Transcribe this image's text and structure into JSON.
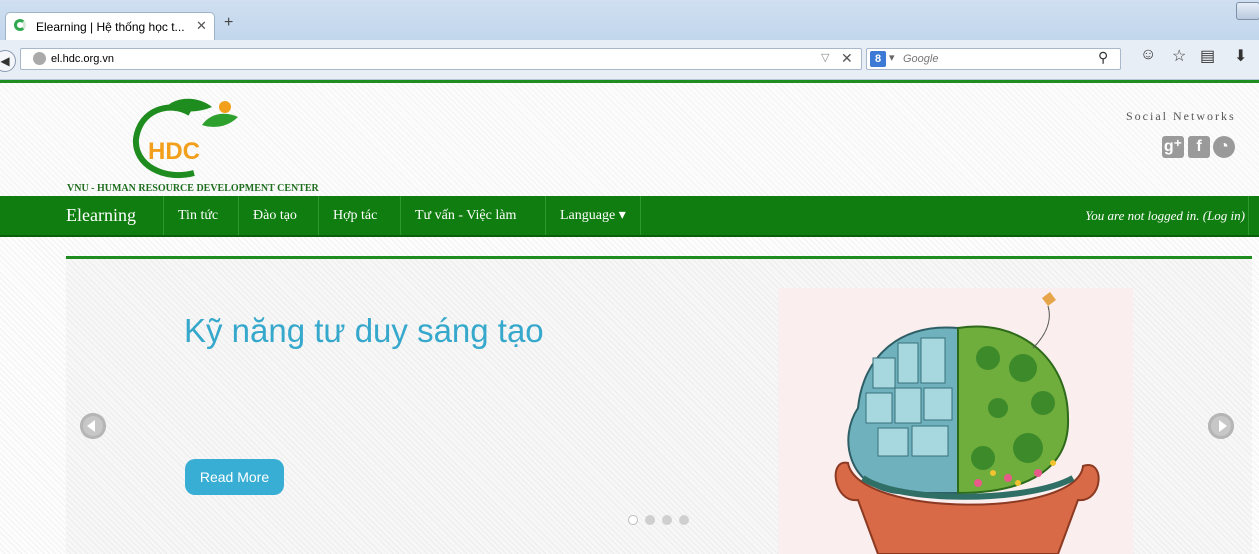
{
  "browser": {
    "tab_title": "Elearning | Hệ thống học t...",
    "tab_close": "✕",
    "new_tab": "+",
    "url": "el.hdc.org.vn",
    "search_placeholder": "Google",
    "search_engine_letter": "8"
  },
  "header": {
    "logo_text": "HDC",
    "logo_caption": "VNU - HUMAN RESOURCE DEVELOPMENT CENTER",
    "social_title": "Social Networks",
    "social_icons": [
      "google-plus-icon",
      "facebook-icon",
      "skype-icon"
    ]
  },
  "menu": {
    "brand": "Elearning",
    "items": [
      "Tin tức",
      "Đào tạo",
      "Hợp tác",
      "Tư vấn - Việc làm",
      "Language ▾"
    ],
    "login_text": "You are not logged in. (Log in)"
  },
  "slider": {
    "title": "Kỹ năng tư duy sáng tạo",
    "read_more": "Read More",
    "dot_count": 4,
    "active_dot": 0
  },
  "colors": {
    "menu_green": "#0f7d0f",
    "accent_blue": "#38aed4"
  }
}
